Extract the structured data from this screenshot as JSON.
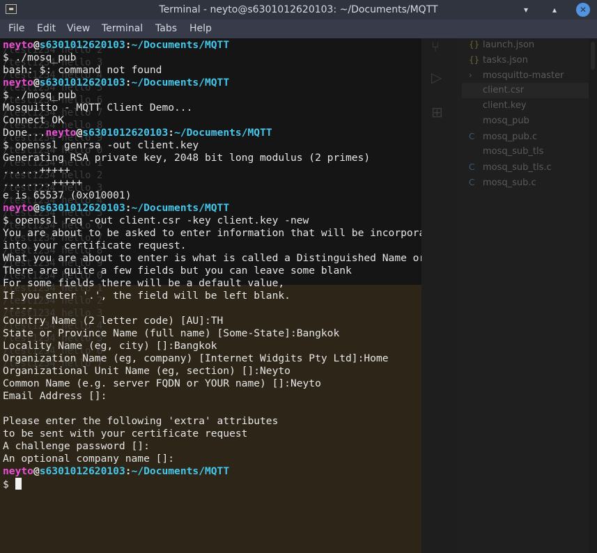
{
  "window": {
    "title": "Terminal - neyto@s6301012620103: ~/Documents/MQTT",
    "minimize_icon": "minimize-icon",
    "maximize_icon": "maximize-icon",
    "close_icon": "close-icon"
  },
  "menu": [
    "File",
    "Edit",
    "View",
    "Terminal",
    "Tabs",
    "Help"
  ],
  "prompt": {
    "user": "neyto",
    "at": "@",
    "host": "s6301012620103",
    "colon": ":",
    "path": "~/Documents/MQTT",
    "symbol": "$"
  },
  "terminal_lines": [
    {
      "type": "prompt"
    },
    {
      "type": "text",
      "text": "$ ./mosq_pub"
    },
    {
      "type": "text",
      "text": "bash: $: command not found"
    },
    {
      "type": "prompt"
    },
    {
      "type": "text",
      "text": "$ ./mosq_pub"
    },
    {
      "type": "text",
      "text": "Mosquitto - MQTT Client Demo..."
    },
    {
      "type": "text",
      "text": "Connect OK"
    },
    {
      "type": "done_prompt",
      "prefix": "Done..."
    },
    {
      "type": "text",
      "text": "$ openssl genrsa -out client.key"
    },
    {
      "type": "text",
      "text": "Generating RSA private key, 2048 bit long modulus (2 primes)"
    },
    {
      "type": "text",
      "text": "......+++++"
    },
    {
      "type": "text",
      "text": "........+++++"
    },
    {
      "type": "text",
      "text": "e is 65537 (0x010001)"
    },
    {
      "type": "prompt"
    },
    {
      "type": "text",
      "text": "$ openssl req -out client.csr -key client.key -new"
    },
    {
      "type": "text",
      "text": "You are about to be asked to enter information that will be incorporated"
    },
    {
      "type": "text",
      "text": "into your certificate request."
    },
    {
      "type": "text",
      "text": "What you are about to enter is what is called a Distinguished Name or a DN."
    },
    {
      "type": "text",
      "text": "There are quite a few fields but you can leave some blank"
    },
    {
      "type": "text",
      "text": "For some fields there will be a default value,"
    },
    {
      "type": "text",
      "text": "If you enter '.', the field will be left blank."
    },
    {
      "type": "text",
      "text": "-----"
    },
    {
      "type": "text",
      "text": "Country Name (2 letter code) [AU]:TH"
    },
    {
      "type": "text",
      "text": "State or Province Name (full name) [Some-State]:Bangkok"
    },
    {
      "type": "text",
      "text": "Locality Name (eg, city) []:Bangkok"
    },
    {
      "type": "text",
      "text": "Organization Name (eg, company) [Internet Widgits Pty Ltd]:Home"
    },
    {
      "type": "text",
      "text": "Organizational Unit Name (eg, section) []:Neyto"
    },
    {
      "type": "text",
      "text": "Common Name (e.g. server FQDN or YOUR name) []:Neyto"
    },
    {
      "type": "text",
      "text": "Email Address []:"
    },
    {
      "type": "text",
      "text": ""
    },
    {
      "type": "text",
      "text": "Please enter the following 'extra' attributes"
    },
    {
      "type": "text",
      "text": "to be sent with your certificate request"
    },
    {
      "type": "text",
      "text": "A challenge password []:"
    },
    {
      "type": "text",
      "text": "An optional company name []:"
    },
    {
      "type": "prompt"
    },
    {
      "type": "cursor_line",
      "text": "$ "
    }
  ],
  "background_ghost_lines": [
    "/test1234 hello 2",
    "/test1234 hello 3",
    "/test1234 hello 4",
    "/test1234 hello 5",
    "/test1234 hello 6",
    "/test1234 hello 7",
    "/test1234 hello 8",
    "/test1234 hello 9",
    "/test1234 hello 0",
    "/test1234 hello 1",
    "/test1234 hello 2",
    "/test1234 hello 3",
    "/test1234 hello 4",
    "/test1234 hello 5",
    "/test1234 hello 6",
    "/test1234 hello 7",
    "/test1234 hello 8",
    "/test1234 hello 9",
    "/test1234 hello 0",
    "/test1234 hello 1",
    "/test1234 hello 2",
    "/test1234 hello 3",
    "/test1234 hello 4",
    "/test1234 hello 5",
    "/test1234 hello 6",
    "/test1234 hello 7"
  ],
  "vscode_files": [
    {
      "name": "launch.json",
      "icon": "json-icon",
      "glyph": "{}"
    },
    {
      "name": "tasks.json",
      "icon": "json-icon",
      "glyph": "{}"
    },
    {
      "name": "mosquitto-master",
      "icon": "chevron-right-icon",
      "glyph": "›"
    },
    {
      "name": "client.csr",
      "icon": "file-icon",
      "glyph": "",
      "selected": true
    },
    {
      "name": "client.key",
      "icon": "file-icon",
      "glyph": ""
    },
    {
      "name": "mosq_pub",
      "icon": "file-icon",
      "glyph": ""
    },
    {
      "name": "mosq_pub.c",
      "icon": "c-file-icon",
      "glyph": "C"
    },
    {
      "name": "mosq_sub_tls",
      "icon": "file-icon",
      "glyph": ""
    },
    {
      "name": "mosq_sub_tls.c",
      "icon": "c-file-icon",
      "glyph": "C"
    },
    {
      "name": "mosq_sub.c",
      "icon": "c-file-icon",
      "glyph": "C"
    }
  ],
  "colors": {
    "user": "#ee4fd8",
    "host": "#44c7ea",
    "text": "#e6e6e6"
  }
}
